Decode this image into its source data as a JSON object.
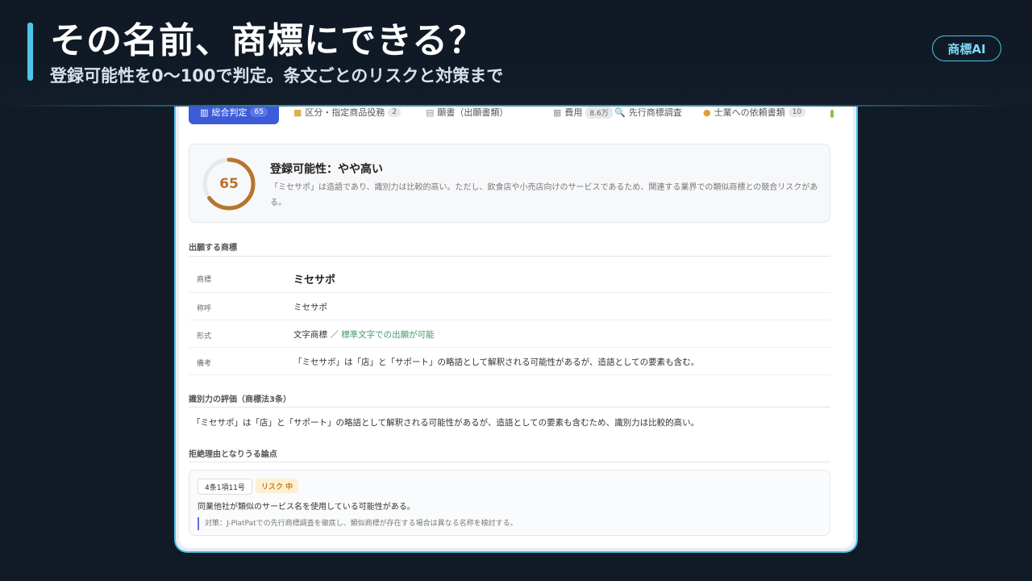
{
  "banner": {
    "title": "その名前、商標にできる？",
    "subtitle": "登録可能性を0〜100で判定。条文ごとのリスクと対策まで",
    "badge": "商標AI"
  },
  "tabs": [
    {
      "label": "総合判定",
      "count": "65",
      "icon": "chart-icon",
      "active": true
    },
    {
      "label": "区分・指定商品役務",
      "count": "2",
      "icon": "folder-icon"
    },
    {
      "label": "願書（出願書類）",
      "count": "",
      "icon": "document-icon"
    },
    {
      "label": "費用",
      "count": "8.6万",
      "icon": "money-icon"
    },
    {
      "label": "先行商標調査",
      "count": "",
      "icon": "search-icon"
    },
    {
      "label": "士業への依頼書類",
      "count": "10",
      "icon": "handshake-icon"
    }
  ],
  "score": {
    "value": 65,
    "value_fraction": 0.65,
    "title": "登録可能性：やや高い",
    "description": "「ミセサポ」は造語であり、識別力は比較的高い。ただし、飲食店や小売店向けのサービスであるため、関連する業界での類似商標との競合リスクがある。",
    "color": "#b7742c"
  },
  "mark_section": {
    "heading": "出願する商標",
    "rows": [
      {
        "key": "商標",
        "value": "ミセサポ"
      },
      {
        "key": "称呼",
        "value": "ミセサポ"
      },
      {
        "key": "形式",
        "value": "文字商標",
        "sep": " ／ ",
        "note": "標準文字での出願が可能"
      },
      {
        "key": "備考",
        "value": "「ミセサポ」は「店」と「サポート」の略語として解釈される可能性があるが、造語としての要素も含む。"
      }
    ]
  },
  "distinct_section": {
    "heading": "識別力の評価（商標法3条）",
    "text": "「ミセサポ」は「店」と「サポート」の略語として解釈される可能性があるが、造語としての要素も含むため、識別力は比較的高い。"
  },
  "refusal_section": {
    "heading": "拒絶理由となりうる論点",
    "items": [
      {
        "article": "4条1項11号",
        "risk": "リスク 中",
        "description": "同業他社が類似のサービス名を使用している可能性がある。",
        "measure": "対策：J-PlatPatでの先行商標調査を徹底し、類似商標が存在する場合は異なる名称を検討する。"
      }
    ]
  }
}
